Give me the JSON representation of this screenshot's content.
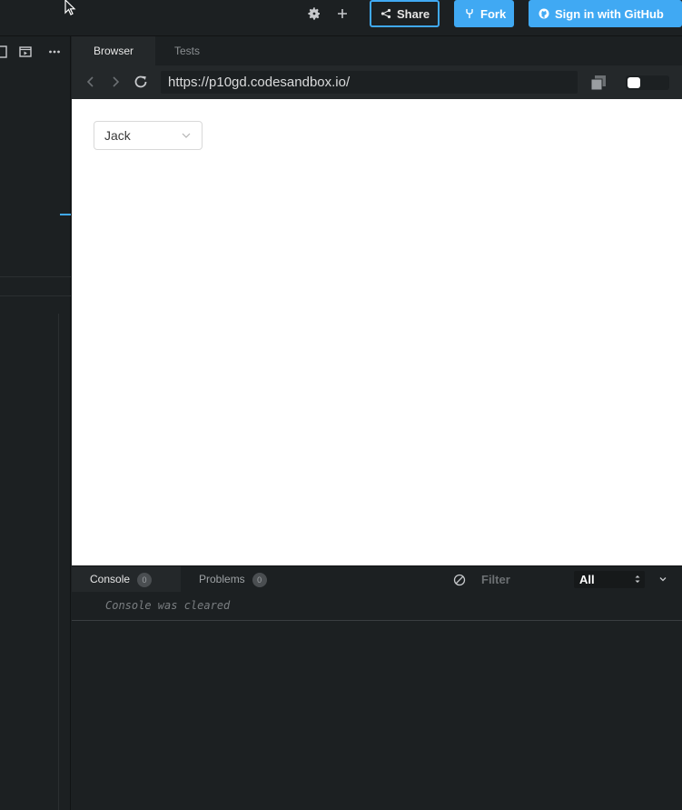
{
  "header": {
    "settings_icon": "gear-icon",
    "add_icon": "plus-icon",
    "share_label": "Share",
    "fork_label": "Fork",
    "github_label": "Sign in with GitHub"
  },
  "browser": {
    "tabs": [
      {
        "label": "Browser",
        "active": true
      },
      {
        "label": "Tests",
        "active": false
      }
    ],
    "url": "https://p10gd.codesandbox.io/"
  },
  "preview": {
    "select_value": "Jack"
  },
  "console": {
    "tabs": [
      {
        "label": "Console",
        "count": "0"
      },
      {
        "label": "Problems",
        "count": "0"
      }
    ],
    "filter_placeholder": "Filter",
    "level": "All",
    "message": "Console was cleared"
  },
  "colors": {
    "accent": "#40a9f3",
    "background": "#1c2022",
    "panel": "#24282a"
  }
}
